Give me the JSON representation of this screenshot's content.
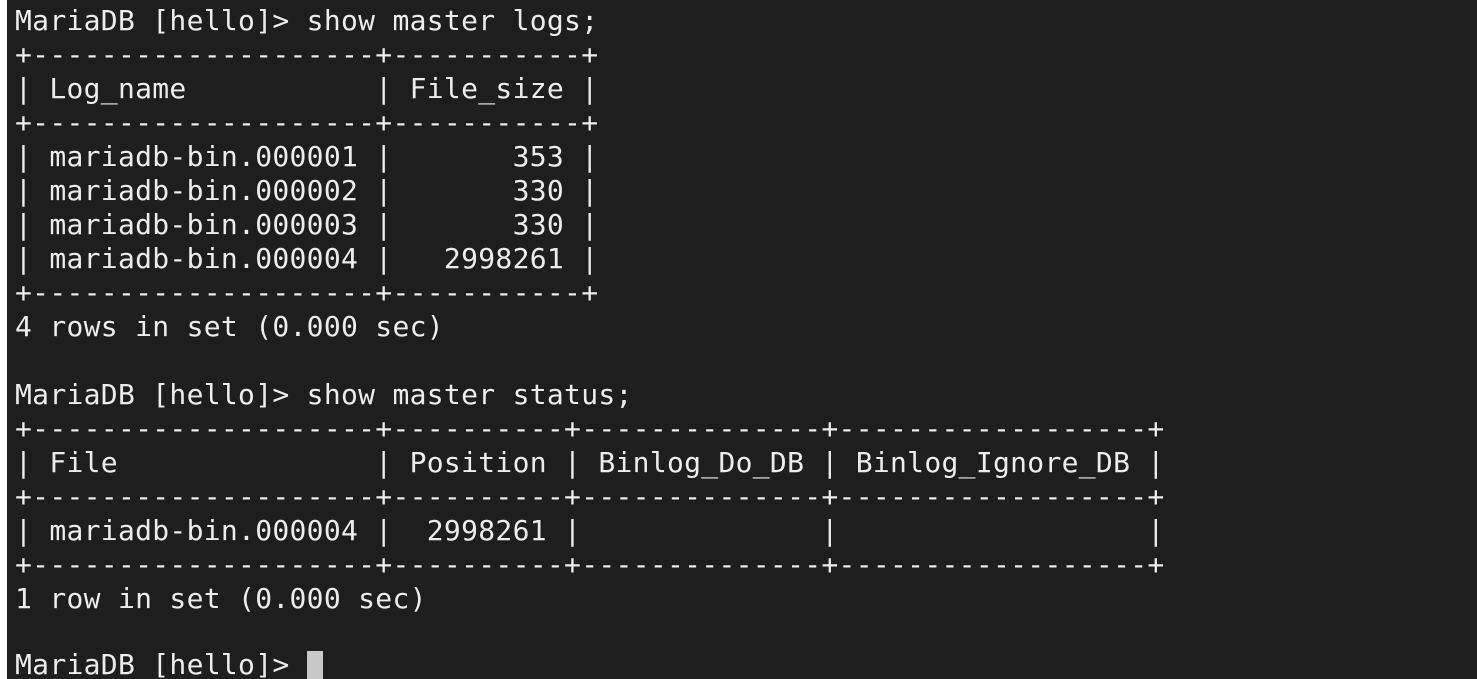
{
  "terminal": {
    "lines": [
      "MariaDB [hello]> show master logs;",
      "+--------------------+-----------+",
      "| Log_name           | File_size |",
      "+--------------------+-----------+",
      "| mariadb-bin.000001 |       353 |",
      "| mariadb-bin.000002 |       330 |",
      "| mariadb-bin.000003 |       330 |",
      "| mariadb-bin.000004 |   2998261 |",
      "+--------------------+-----------+",
      "4 rows in set (0.000 sec)",
      "",
      "MariaDB [hello]> show master status;",
      "+--------------------+----------+--------------+------------------+",
      "| File               | Position | Binlog_Do_DB | Binlog_Ignore_DB |",
      "+--------------------+----------+--------------+------------------+",
      "| mariadb-bin.000004 |  2998261 |              |                  |",
      "+--------------------+----------+--------------+------------------+",
      "1 row in set (0.000 sec)",
      "",
      "MariaDB [hello]> "
    ],
    "colors": {
      "background": "#1e1e1e",
      "foreground": "#ececec",
      "cursor": "#c8c8c8"
    }
  }
}
